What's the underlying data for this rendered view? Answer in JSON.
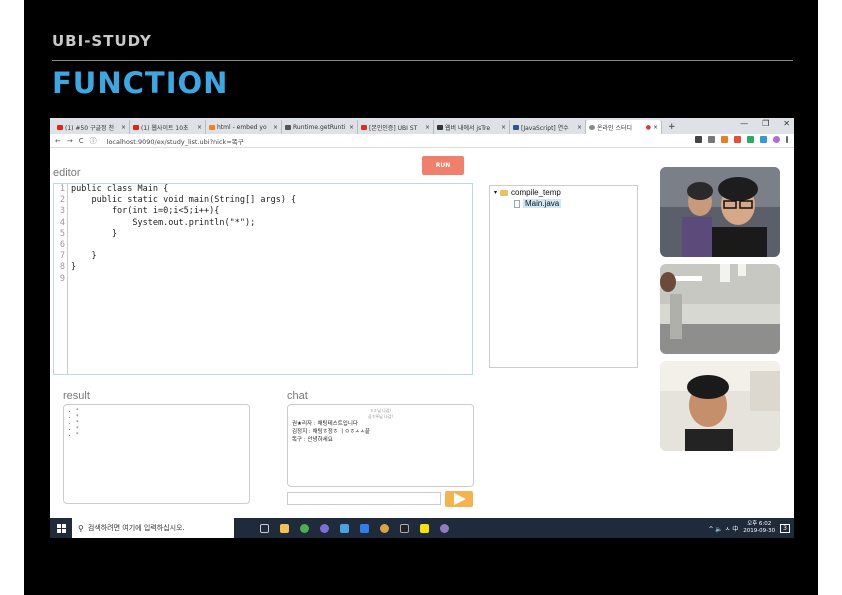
{
  "slide": {
    "title": "UBI-STUDY",
    "heading": "FUNCTION"
  },
  "browser": {
    "tabs": [
      {
        "label": "(1) #50 구글정 천",
        "favicon_color": "#e62117"
      },
      {
        "label": "(1) 웹사이트 10초",
        "favicon_color": "#e62117"
      },
      {
        "label": "html - embed yo",
        "favicon_color": "#f48024"
      },
      {
        "label": "Runtime.getRunti",
        "favicon_color": "#555555"
      },
      {
        "label": "[본인인증] UBI ST",
        "favicon_color": "#d93025"
      },
      {
        "label": "웹버 내에서 jsTre",
        "favicon_color": "#333333"
      },
      {
        "label": "[JavaScript] 연수",
        "favicon_color": "#2b5797"
      },
      {
        "label": "온라인 스터디",
        "favicon_color": "#888888"
      }
    ],
    "tab_close": "×",
    "new_tab": "+",
    "window_controls": {
      "minimize": "—",
      "maximize": "❐",
      "close": "✕"
    },
    "nav": {
      "back": "←",
      "forward": "→",
      "reload": "C",
      "info": "ⓘ"
    },
    "url": "localhost:9090/ex/study_list.ubi?nick=똑구"
  },
  "app": {
    "editor_label": "editor",
    "run_label": "RUN",
    "line_numbers": [
      "1",
      "2",
      "3",
      "4",
      "5",
      "6",
      "7",
      "8",
      "9"
    ],
    "code_lines": [
      "public class Main {",
      "    public static void main(String[] args) {",
      "        for(int i=0;i<5;i++){",
      "            System.out.println(\"*\");",
      "        }",
      "",
      "    }",
      "}",
      ""
    ],
    "tree": {
      "toggle": "▾",
      "folder": "compile_temp",
      "file": "Main.java"
    },
    "result_label": "result",
    "result_lines": [
      "*",
      "*",
      "*",
      "*",
      "*"
    ],
    "chat_label": "chat",
    "chat_system": [
      "ㅎㅎ님 나감!",
      "공ㅎ뚜님 나감!"
    ],
    "chat_messages": [
      "권★리자 : 채팅테스트입니다",
      "김정지 : 채팅ㅎ정ㅎ ㅣㅇㅎㅅㅅ끝",
      "똑구 : 안녕하세요"
    ]
  },
  "taskbar": {
    "search_placeholder": "검색하려면 여기에 입력하십시오.",
    "tray_icons": "^ 🔈 ㅅ 中",
    "time": "오후 6:02",
    "date": "2019-09-30",
    "notification": "3"
  },
  "colors": {
    "run_button": "#f0806c",
    "send_button": "#f5b350",
    "heading": "#3aa8e2"
  }
}
